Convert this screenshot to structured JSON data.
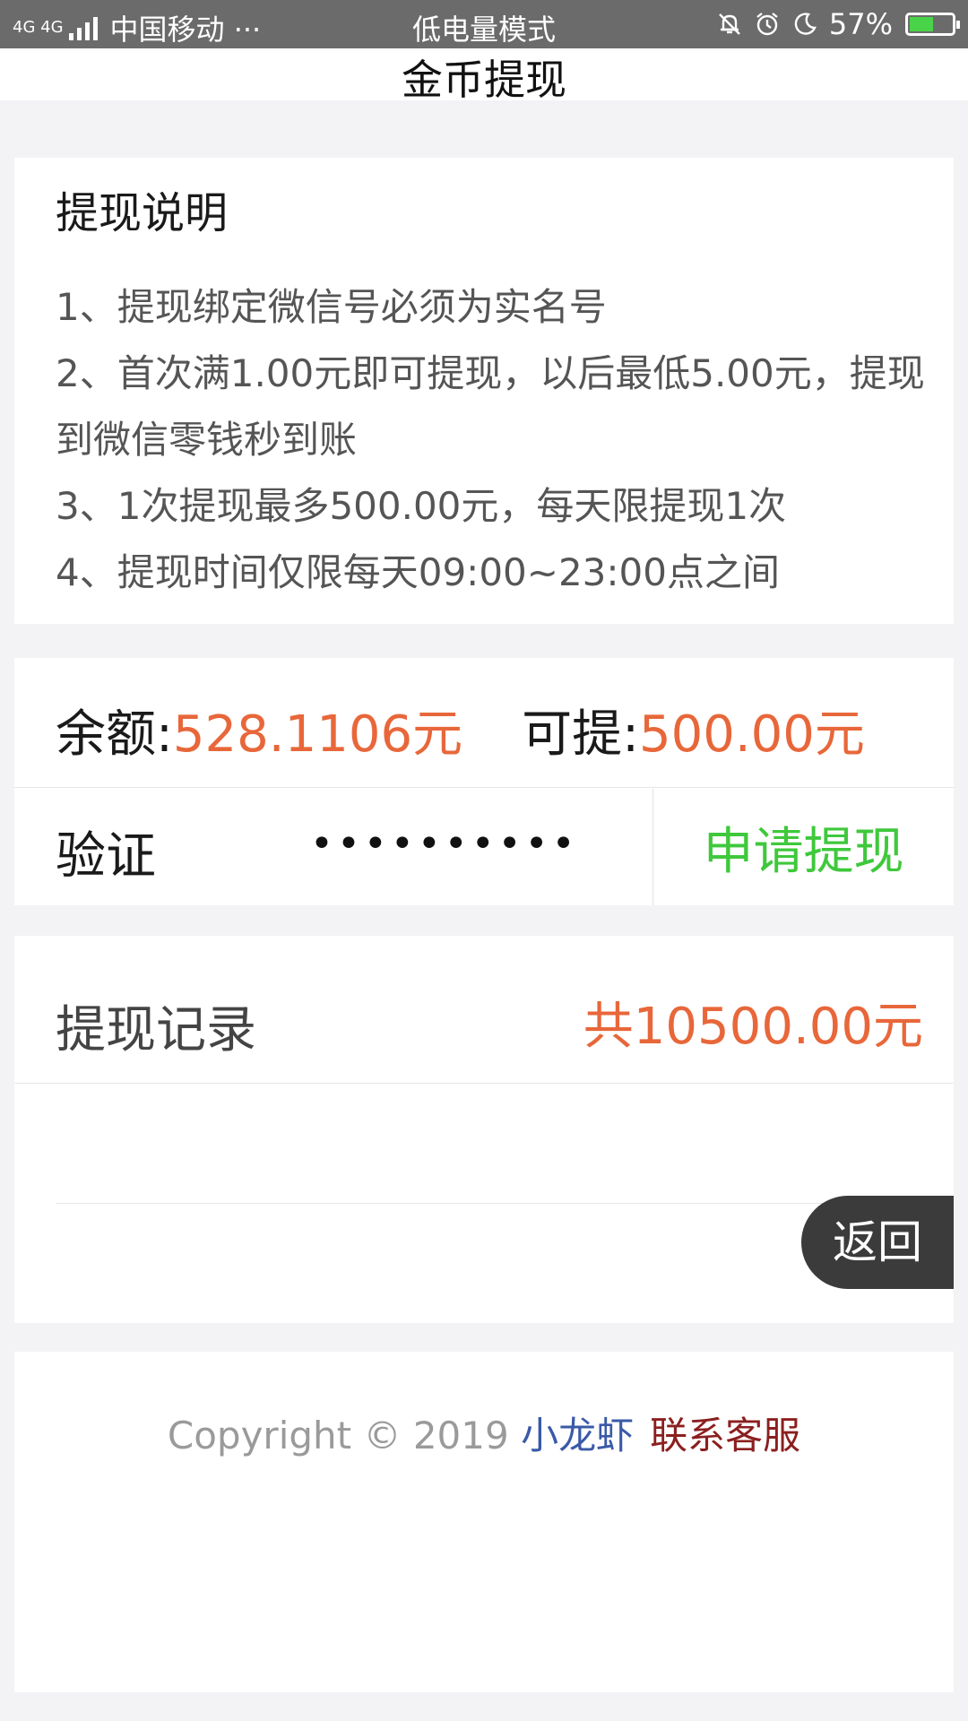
{
  "status_bar": {
    "network": "4G 4G",
    "carrier": "中国移动 ···",
    "mode": "低电量模式",
    "battery": "57%",
    "battery_level": 0.57,
    "icons": [
      "bell-off-icon",
      "alarm-icon",
      "moon-icon",
      "battery-charging-icon"
    ]
  },
  "header": {
    "title": "金币提现"
  },
  "instructions": {
    "title": "提现说明",
    "lines": [
      "1、提现绑定微信号必须为实名号",
      "2、首次满1.00元即可提现，以后最低5.00元，提现到微信零钱秒到账",
      "3、1次提现最多500.00元，每天限提现1次",
      "4、提现时间仅限每天09:00~23:00点之间"
    ]
  },
  "balance": {
    "balance_label": "余额:",
    "balance_value": "528.1106元",
    "withdrawable_label": "可提:",
    "withdrawable_value": "500.00元",
    "verify_label": "验证",
    "verify_value": "••••••••••",
    "apply_button": "申请提现"
  },
  "records": {
    "label": "提现记录",
    "total": "共10500.00元"
  },
  "back_button": "返回",
  "footer": {
    "copyright": "Copyright © 2019",
    "brand": "小龙虾",
    "contact": "联系客服"
  },
  "colors": {
    "accent_orange": "#e8673a",
    "apply_green": "#3fc83c",
    "brand_blue": "#3a5aa8",
    "contact_red": "#8b1f1f"
  }
}
